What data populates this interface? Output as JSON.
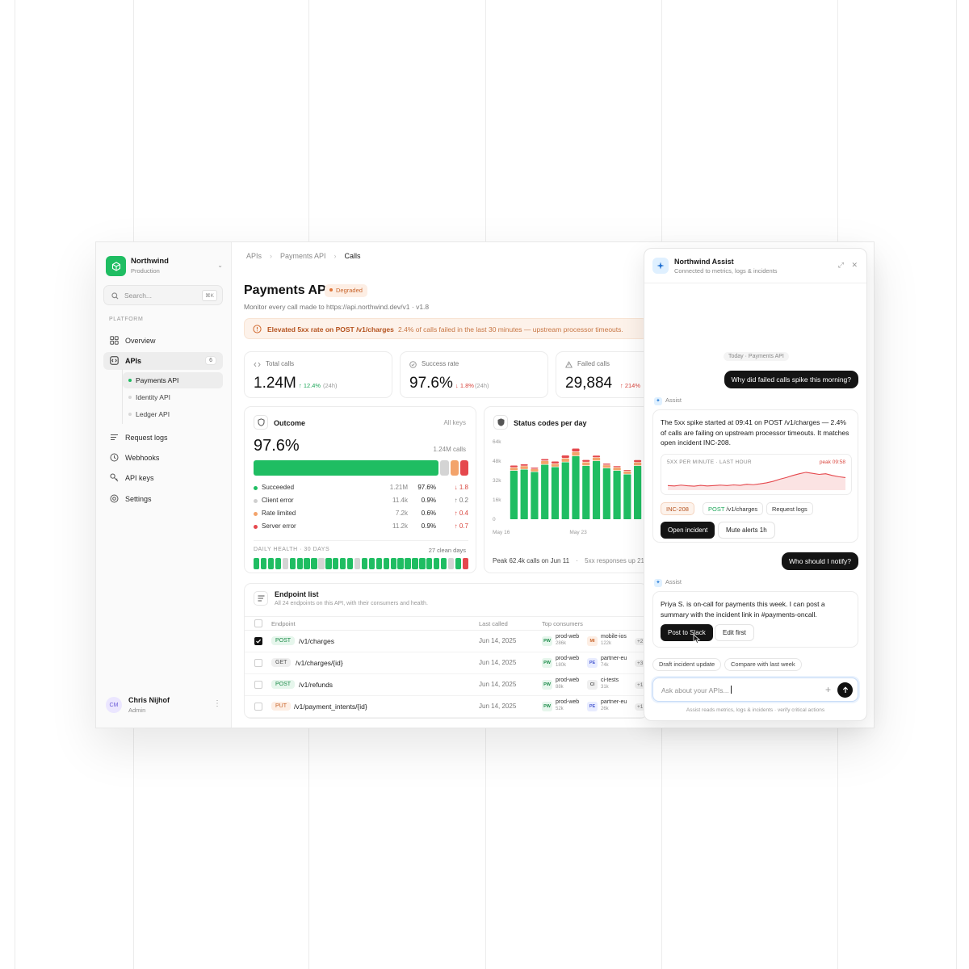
{
  "org": {
    "name": "Northwind",
    "env": "Production"
  },
  "search": {
    "placeholder": "Search...",
    "shortcut": "⌘K"
  },
  "sidebar": {
    "section_label": "PLATFORM",
    "items": [
      {
        "label": "Overview",
        "icon": "grid-icon"
      },
      {
        "label": "APIs",
        "icon": "code-icon",
        "badge": "6"
      },
      {
        "label": "Request logs",
        "icon": "list-icon"
      },
      {
        "label": "Webhooks",
        "icon": "clock-icon"
      },
      {
        "label": "API keys",
        "icon": "key-icon"
      },
      {
        "label": "Settings",
        "icon": "gear-icon"
      }
    ],
    "sub_items": [
      "Payments API",
      "Identity API",
      "Ledger API"
    ]
  },
  "user": {
    "initials": "CM",
    "name": "Chris Nijhof",
    "role": "Admin"
  },
  "breadcrumbs": [
    "APIs",
    "Payments API",
    "Calls"
  ],
  "page": {
    "title": "Payments API",
    "status": "Degraded",
    "subtitle": "Monitor every call made to https://api.northwind.dev/v1 · v1.8"
  },
  "alert": {
    "strong": "Elevated 5xx rate on POST /v1/charges",
    "rest": "2.4% of calls failed in the last 30 minutes — upstream processor timeouts."
  },
  "kpis": [
    {
      "label": "Total calls",
      "value": "1.24M",
      "delta": "↑ 12.4%",
      "period": "(24h)",
      "trend": "up"
    },
    {
      "label": "Success rate",
      "value": "97.6%",
      "delta": "↓ 1.8%",
      "period": "(24h)",
      "trend": "down"
    },
    {
      "label": "Failed calls",
      "value": "29,884",
      "delta": "↑ 214%",
      "period": "",
      "trend": "down"
    }
  ],
  "outcome": {
    "title": "Outcome",
    "scope": "All keys",
    "value": "97.6%",
    "calls": "1.24M calls",
    "rows": [
      {
        "name": "Succeeded",
        "count": "1.21M",
        "pct": "97.6%",
        "delta": "↓ 1.8",
        "color": "#1fbd62",
        "delta_color": "#d9463e"
      },
      {
        "name": "Client error",
        "count": "11.4k",
        "pct": "0.9%",
        "delta": "↑ 0.2",
        "color": "#cfcfcf",
        "delta_color": "#777777"
      },
      {
        "name": "Rate limited",
        "count": "7.2k",
        "pct": "0.6%",
        "delta": "↑ 0.4",
        "color": "#f3a36b",
        "delta_color": "#d9463e"
      },
      {
        "name": "Server error",
        "count": "11.2k",
        "pct": "0.9%",
        "delta": "↑ 0.7",
        "color": "#e5484d",
        "delta_color": "#d9463e"
      }
    ],
    "health_label": "DAILY HEALTH · 30 DAYS",
    "health_clean": "27 clean days",
    "health_days": [
      "g",
      "g",
      "g",
      "g",
      "x",
      "g",
      "g",
      "g",
      "g",
      "x",
      "g",
      "g",
      "g",
      "g",
      "x",
      "g",
      "g",
      "g",
      "g",
      "g",
      "g",
      "g",
      "g",
      "g",
      "g",
      "g",
      "g",
      "x",
      "g",
      "r"
    ]
  },
  "status_chart": {
    "title": "Status codes per day",
    "peak_note": "Peak 62.4k calls on Jun 11",
    "sep": "·",
    "trend_note": "5xx responses up 21"
  },
  "chart_data": {
    "type": "bar",
    "title": "Status codes per day",
    "stacked": true,
    "x": [
      "May 16",
      "May 17",
      "May 18",
      "May 19",
      "May 20",
      "May 21",
      "May 22",
      "May 23",
      "May 24",
      "May 25",
      "May 26",
      "May 27",
      "May 28"
    ],
    "x_tick_labels": [
      "May 16",
      "May 23"
    ],
    "y_ticks": [
      "0",
      "16k",
      "32k",
      "48k",
      "64k"
    ],
    "ylim": [
      0,
      64000
    ],
    "series": [
      {
        "name": "2xx",
        "color": "#1fbd62",
        "values": [
          40000,
          41000,
          39000,
          45000,
          43000,
          47000,
          52000,
          44000,
          48000,
          42000,
          40000,
          37000,
          44000
        ]
      },
      {
        "name": "4xx",
        "color": "#f3a36b",
        "values": [
          2500,
          2800,
          2300,
          3000,
          2700,
          3200,
          3500,
          3000,
          2800,
          2600,
          2600,
          2500,
          2800
        ]
      },
      {
        "name": "5xx",
        "color": "#e5484d",
        "values": [
          1800,
          1500,
          1300,
          1700,
          2000,
          2500,
          2800,
          1900,
          1700,
          1300,
          1200,
          1100,
          2000
        ]
      }
    ]
  },
  "endpoints": {
    "title": "Endpoint list",
    "subtitle": "All 24 endpoints on this API, with their consumers and health.",
    "columns": [
      "Endpoint",
      "Last called",
      "Top consumers"
    ],
    "rows": [
      {
        "method": "POST",
        "path": "/v1/charges",
        "last": "Jun 14, 2025",
        "checked": true,
        "c1": {
          "badge": "PW",
          "name": "prod-web",
          "num": "286k"
        },
        "c2": {
          "badge": "MI",
          "name": "mobile-ios",
          "num": "122k"
        },
        "more": "+2"
      },
      {
        "method": "GET",
        "path": "/v1/charges/{id}",
        "last": "Jun 14, 2025",
        "checked": false,
        "c1": {
          "badge": "PW",
          "name": "prod-web",
          "num": "180k"
        },
        "c2": {
          "badge": "PE",
          "name": "partner-eu",
          "num": "74k"
        },
        "more": "+3"
      },
      {
        "method": "POST",
        "path": "/v1/refunds",
        "last": "Jun 14, 2025",
        "checked": false,
        "c1": {
          "badge": "PW",
          "name": "prod-web",
          "num": "88k"
        },
        "c2": {
          "badge": "CI",
          "name": "ci-tests",
          "num": "31k"
        },
        "more": "+1"
      },
      {
        "method": "PUT",
        "path": "/v1/payment_intents/{id}",
        "last": "Jun 14, 2025",
        "checked": false,
        "c1": {
          "badge": "PW",
          "name": "prod-web",
          "num": "52k"
        },
        "c2": {
          "badge": "PE",
          "name": "partner-eu",
          "num": "26k"
        },
        "more": "+1"
      }
    ]
  },
  "assist": {
    "title": "Northwind Assist",
    "subtitle": "Connected to metrics, logs & incidents",
    "day": "Today · Payments API",
    "q1": "Why did failed calls spike this morning?",
    "tag": "Assist",
    "a1": "The 5xx spike started at 09:41 on POST /v1/charges — 2.4% of calls are failing on upstream processor timeouts. It matches open incident INC-208.",
    "mini_label": "5XX PER MINUTE · LAST HOUR",
    "mini_peak": "peak 09:58",
    "mini_values": [
      0.22,
      0.2,
      0.24,
      0.21,
      0.19,
      0.23,
      0.2,
      0.22,
      0.24,
      0.22,
      0.25,
      0.23,
      0.28,
      0.26,
      0.3,
      0.35,
      0.42,
      0.52,
      0.6,
      0.7,
      0.78,
      0.85,
      0.8,
      0.75,
      0.78,
      0.7,
      0.64,
      0.6
    ],
    "chips": {
      "inc": "INC-208",
      "method": "POST",
      "path": "/v1/charges",
      "logs": "Request logs"
    },
    "btn_open": "Open incident",
    "btn_mute": "Mute alerts 1h",
    "q2": "Who should I notify?",
    "a2": "Priya S. is on-call for payments this week. I can post a summary with the incident link in #payments-oncall.",
    "btn_slack": "Post to Slack",
    "btn_edit": "Edit first",
    "suggestions": [
      "Draft incident update",
      "Compare with last week"
    ],
    "composer_placeholder": "Ask about your APIs...",
    "footer": "Assist reads metrics, logs & incidents · verify critical actions"
  }
}
